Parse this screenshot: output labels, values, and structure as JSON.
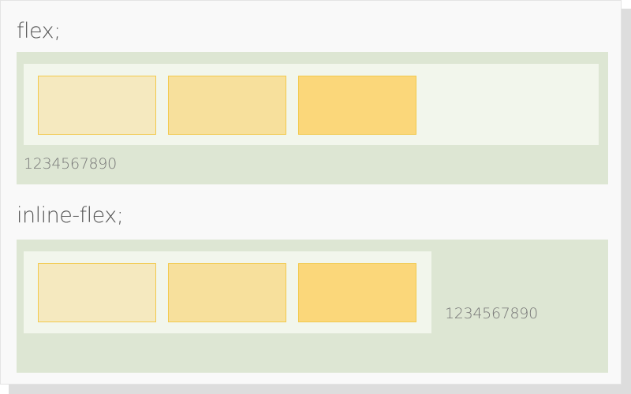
{
  "sections": [
    {
      "heading": "flex;",
      "boxes": [
        {
          "color": "#f5e9bf"
        },
        {
          "color": "#f7e09c"
        },
        {
          "color": "#fbd77a"
        }
      ],
      "trailing_text": "1234567890"
    },
    {
      "heading": "inline-flex;",
      "boxes": [
        {
          "color": "#f5e9bf"
        },
        {
          "color": "#f7e09c"
        },
        {
          "color": "#fbd77a"
        }
      ],
      "trailing_text": "1234567890"
    }
  ],
  "colors": {
    "outer_background": "#dde6d3",
    "container_background": "#f2f6ec",
    "box_border": "#f2c94c",
    "card_background": "#f9f9f9"
  }
}
